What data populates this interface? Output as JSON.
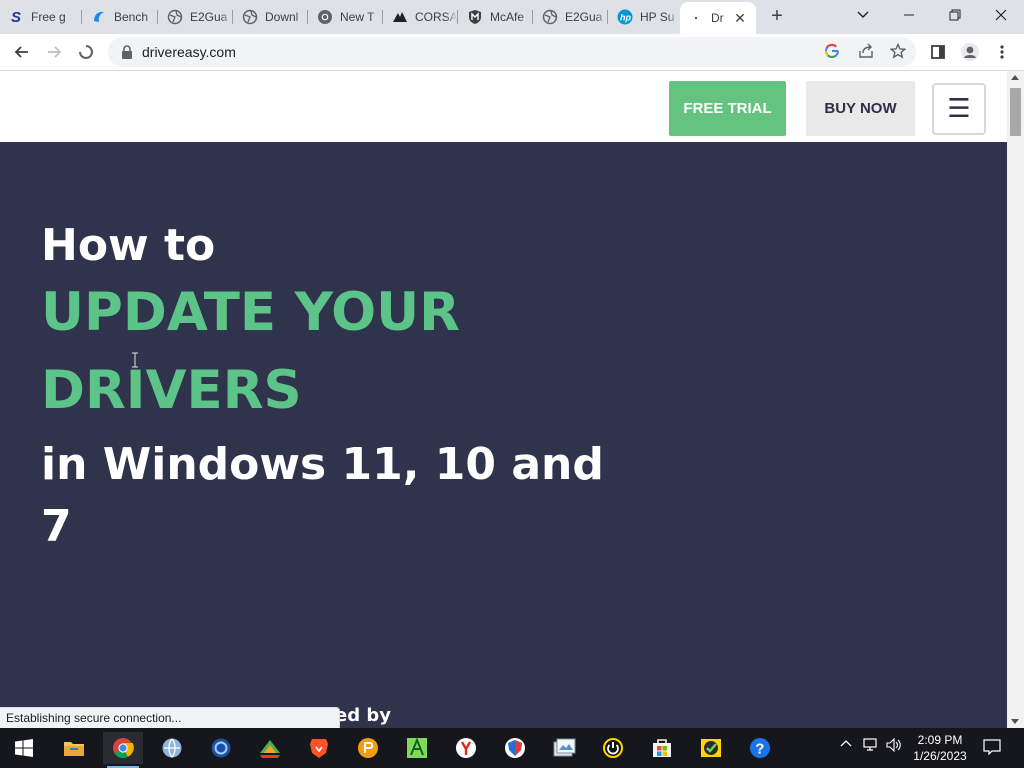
{
  "browser": {
    "tabs": [
      {
        "title": "Free g",
        "icon": "s-logo-icon"
      },
      {
        "title": "Bench",
        "icon": "benchmark-icon"
      },
      {
        "title": "E2Gua",
        "icon": "globe-icon"
      },
      {
        "title": "Downl",
        "icon": "globe-icon"
      },
      {
        "title": "New T",
        "icon": "chrome-icon"
      },
      {
        "title": "CORSA",
        "icon": "corsair-icon"
      },
      {
        "title": "McAfe",
        "icon": "mcafee-icon"
      },
      {
        "title": "E2Gua",
        "icon": "globe-icon"
      },
      {
        "title": "HP Su",
        "icon": "hp-icon"
      },
      {
        "title": "Dr",
        "icon": "loading-icon"
      }
    ],
    "address": "drivereasy.com",
    "status_text": "Establishing secure connection..."
  },
  "site": {
    "free_trial_label": "FREE TRIAL",
    "buy_now_label": "BUY NOW",
    "menu_glyph": "☰"
  },
  "hero": {
    "line1": "How to",
    "line2": "UPDATE YOUR",
    "line3": "DRIVERS",
    "line4": "in Windows 11, 10 and",
    "line5": "7",
    "tail": "ed by"
  },
  "taskbar": {
    "time": "2:09 PM",
    "date": "1/26/2023"
  },
  "colors": {
    "hero_bg": "#30334c",
    "accent_green": "#5cc488",
    "trial_button": "#63c37f"
  }
}
